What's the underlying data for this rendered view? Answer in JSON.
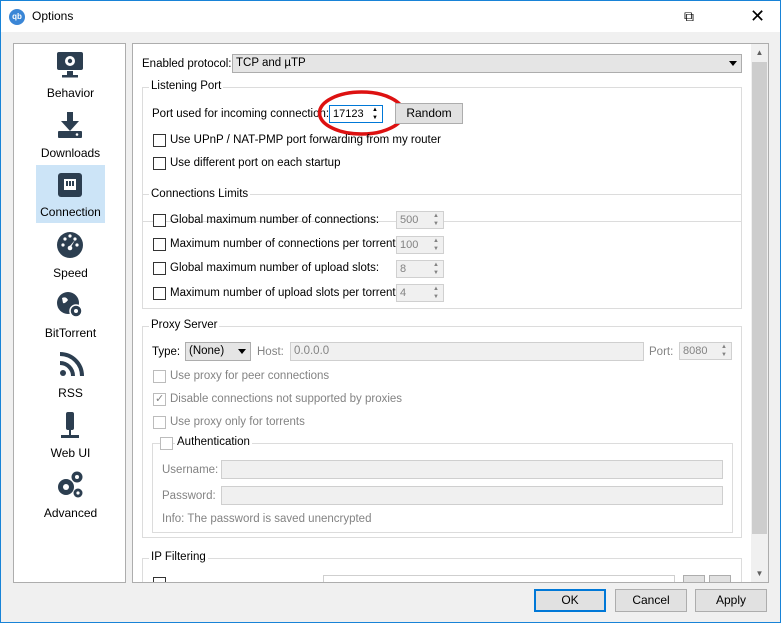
{
  "window": {
    "title": "Options",
    "help_glyph": "⧉",
    "close_glyph": "✕",
    "app_icon_text": "qb"
  },
  "sidebar": {
    "items": [
      {
        "label": "Behavior",
        "icon": "monitor-icon"
      },
      {
        "label": "Downloads",
        "icon": "download-icon"
      },
      {
        "label": "Connection",
        "icon": "network-icon",
        "selected": true
      },
      {
        "label": "Speed",
        "icon": "speedometer-icon"
      },
      {
        "label": "BitTorrent",
        "icon": "globe-gear-icon"
      },
      {
        "label": "RSS",
        "icon": "rss-icon"
      },
      {
        "label": "Web UI",
        "icon": "plug-icon"
      },
      {
        "label": "Advanced",
        "icon": "gears-icon"
      }
    ]
  },
  "protocol": {
    "label": "Enabled protocol:",
    "value": "TCP and µTP"
  },
  "listening": {
    "title": "Listening Port",
    "port_label": "Port used for incoming connection:",
    "port_value": "17123",
    "random_label": "Random",
    "upnp_label": "Use UPnP / NAT-PMP port forwarding from my router",
    "diff_port_label": "Use different port on each startup"
  },
  "limits": {
    "title": "Connections Limits",
    "rows": [
      {
        "label": "Global maximum number of connections:",
        "value": "500"
      },
      {
        "label": "Maximum number of connections per torrent:",
        "value": "100"
      },
      {
        "label": "Global maximum number of upload slots:",
        "value": "8"
      },
      {
        "label": "Maximum number of upload slots per torrent:",
        "value": "4"
      }
    ]
  },
  "proxy": {
    "title": "Proxy Server",
    "type_label": "Type:",
    "type_value": "(None)",
    "host_label": "Host:",
    "host_value": "0.0.0.0",
    "port_label": "Port:",
    "port_value": "8080",
    "peer_label": "Use proxy for peer connections",
    "disable_label": "Disable connections not supported by proxies",
    "torrents_only_label": "Use proxy only for torrents",
    "auth_label": "Authentication",
    "username_label": "Username:",
    "password_label": "Password:",
    "info": "Info: The password is saved unencrypted"
  },
  "ipfilter": {
    "title": "IP Filtering"
  },
  "footer": {
    "ok": "OK",
    "cancel": "Cancel",
    "apply": "Apply"
  },
  "colors": {
    "highlight": "#cc0000",
    "selected": "#cce4f7",
    "accent": "#0078d7"
  }
}
